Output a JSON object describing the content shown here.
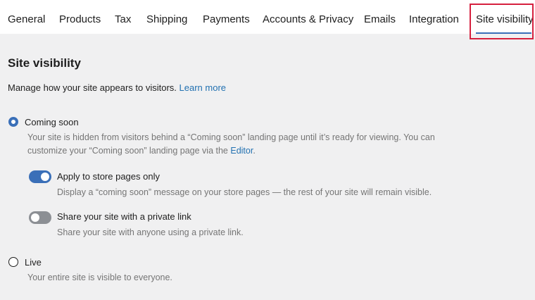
{
  "nav": {
    "tabs": [
      {
        "label": "General"
      },
      {
        "label": "Products"
      },
      {
        "label": "Tax"
      },
      {
        "label": "Shipping"
      },
      {
        "label": "Payments"
      },
      {
        "label": "Accounts & Privacy"
      },
      {
        "label": "Emails"
      },
      {
        "label": "Integration"
      },
      {
        "label": "Site visibility",
        "active": true
      }
    ]
  },
  "section": {
    "title": "Site visibility",
    "description": "Manage how your site appears to visitors.",
    "learn_more": "Learn more"
  },
  "coming_soon": {
    "label": "Coming soon",
    "selected": true,
    "help_line1": "Your site is hidden from visitors behind a “Coming soon” landing page until it’s ready for viewing. You can",
    "help_line2_prefix": "customize your “Coming soon” landing page via the ",
    "help_link": "Editor",
    "help_line2_suffix": "."
  },
  "store_pages_toggle": {
    "label": "Apply to store pages only",
    "enabled": true,
    "help": "Display a “coming soon” message on your store pages — the rest of your site will remain visible."
  },
  "private_link_toggle": {
    "label": "Share your site with a private link",
    "enabled": false,
    "help": "Share your site with anyone using a private link."
  },
  "live": {
    "label": "Live",
    "selected": false,
    "help": "Your entire site is visible to everyone."
  },
  "colors": {
    "accent": "#3a6fb8",
    "highlight": "#d6203e",
    "link": "#2271b1"
  }
}
